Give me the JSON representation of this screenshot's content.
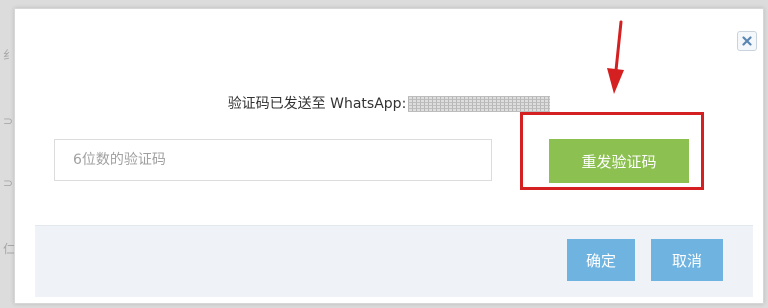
{
  "background": {
    "glyphs": [
      "纟",
      "⊃",
      "⊃",
      "仁"
    ]
  },
  "dialog": {
    "message_prefix": "验证码已发送至 WhatsApp:",
    "masked_number_icon": "redacted-phone-number",
    "code_input": {
      "placeholder": "6位数的验证码",
      "value": ""
    },
    "resend_label": "重发验证码",
    "close_icon": "close-icon",
    "footer": {
      "ok_label": "确定",
      "cancel_label": "取消"
    }
  },
  "annotation": {
    "arrow_icon": "arrow-icon",
    "highlight_color": "#d42020"
  },
  "colors": {
    "resend_button": "#8cc152",
    "primary_button": "#6fb3e0",
    "footer_background": "#eff3f8"
  }
}
